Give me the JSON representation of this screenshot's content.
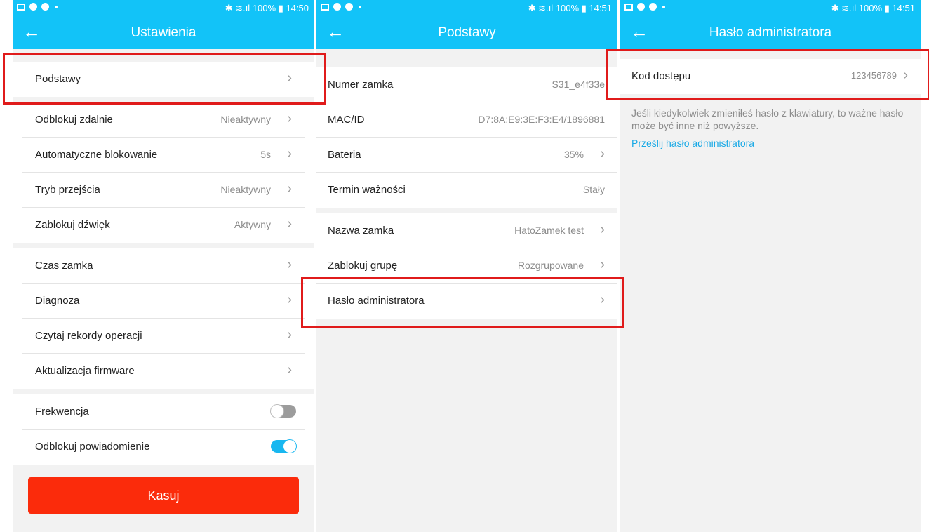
{
  "status": {
    "s1_time": "100% ▮ 14:50",
    "s2_time": "100% ▮ 14:51",
    "s3_time": "100% ▮ 14:51",
    "bt": "✱ ≋.ıl"
  },
  "screen1": {
    "title": "Ustawienia",
    "group1": [
      {
        "label": "Podstawy",
        "value": ""
      }
    ],
    "group2": [
      {
        "label": "Odblokuj zdalnie",
        "value": "Nieaktywny"
      },
      {
        "label": "Automatyczne blokowanie",
        "value": "5s"
      },
      {
        "label": "Tryb przejścia",
        "value": "Nieaktywny"
      },
      {
        "label": "Zablokuj dźwięk",
        "value": "Aktywny"
      }
    ],
    "group3": [
      {
        "label": "Czas zamka"
      },
      {
        "label": "Diagnoza"
      },
      {
        "label": "Czytaj rekordy operacji"
      },
      {
        "label": "Aktualizacja firmware"
      }
    ],
    "toggles": [
      {
        "label": "Frekwencja",
        "state": "off"
      },
      {
        "label": "Odblokuj powiadomienie",
        "state": "on"
      }
    ],
    "delete_label": "Kasuj"
  },
  "screen2": {
    "title": "Podstawy",
    "group1": [
      {
        "label": "Numer zamka",
        "value": "S31_e4f33e"
      },
      {
        "label": "MAC/ID",
        "value": "D7:8A:E9:3E:F3:E4/1896881"
      },
      {
        "label": "Bateria",
        "value": "35%"
      },
      {
        "label": "Termin ważności",
        "value": "Stały"
      }
    ],
    "group2": [
      {
        "label": "Nazwa zamka",
        "value": "HatoZamek test"
      },
      {
        "label": "Zablokuj grupę",
        "value": "Rozgrupowane"
      },
      {
        "label": "Hasło administratora",
        "value": ""
      }
    ]
  },
  "screen3": {
    "title": "Hasło administratora",
    "row": {
      "label": "Kod dostępu",
      "value": "123456789"
    },
    "note": "Jeśli kiedykolwiek zmieniłeś hasło z klawiatury, to ważne hasło może być inne niż powyższe.",
    "link": "Prześlij hasło administratora"
  },
  "colors": {
    "accent": "#12c3f8",
    "danger": "#fb2b0b",
    "highlight": "#e01b1b"
  }
}
